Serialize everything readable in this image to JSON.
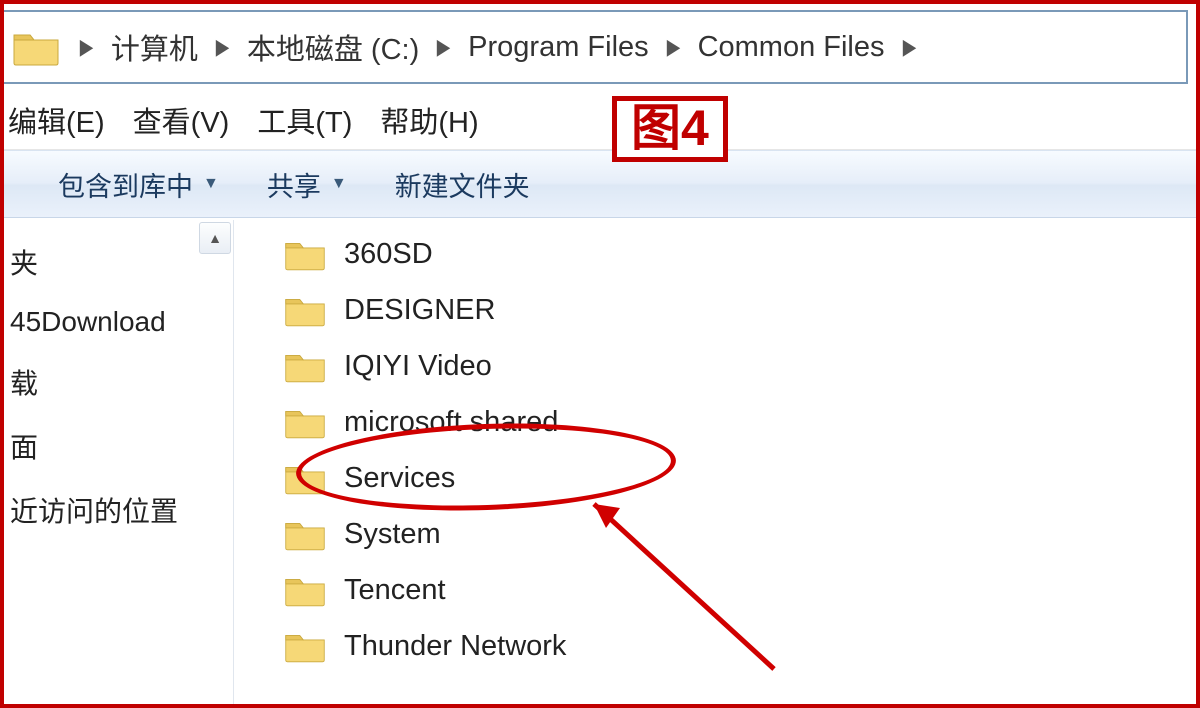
{
  "breadcrumb": {
    "items": [
      "计算机",
      "本地磁盘 (C:)",
      "Program Files",
      "Common Files"
    ]
  },
  "menu": {
    "edit": "编辑(E)",
    "view": "查看(V)",
    "tools": "工具(T)",
    "help": "帮助(H)"
  },
  "toolbar": {
    "include": "包含到库中",
    "share": "共享",
    "newfolder": "新建文件夹"
  },
  "sidebar": {
    "items": [
      "夹",
      "45Download",
      "载",
      "面",
      "近访问的位置"
    ]
  },
  "folders": [
    "360SD",
    "DESIGNER",
    "IQIYI Video",
    "microsoft shared",
    "Services",
    "System",
    "Tencent",
    "Thunder Network"
  ],
  "annotation": {
    "figure_label": "图4"
  }
}
